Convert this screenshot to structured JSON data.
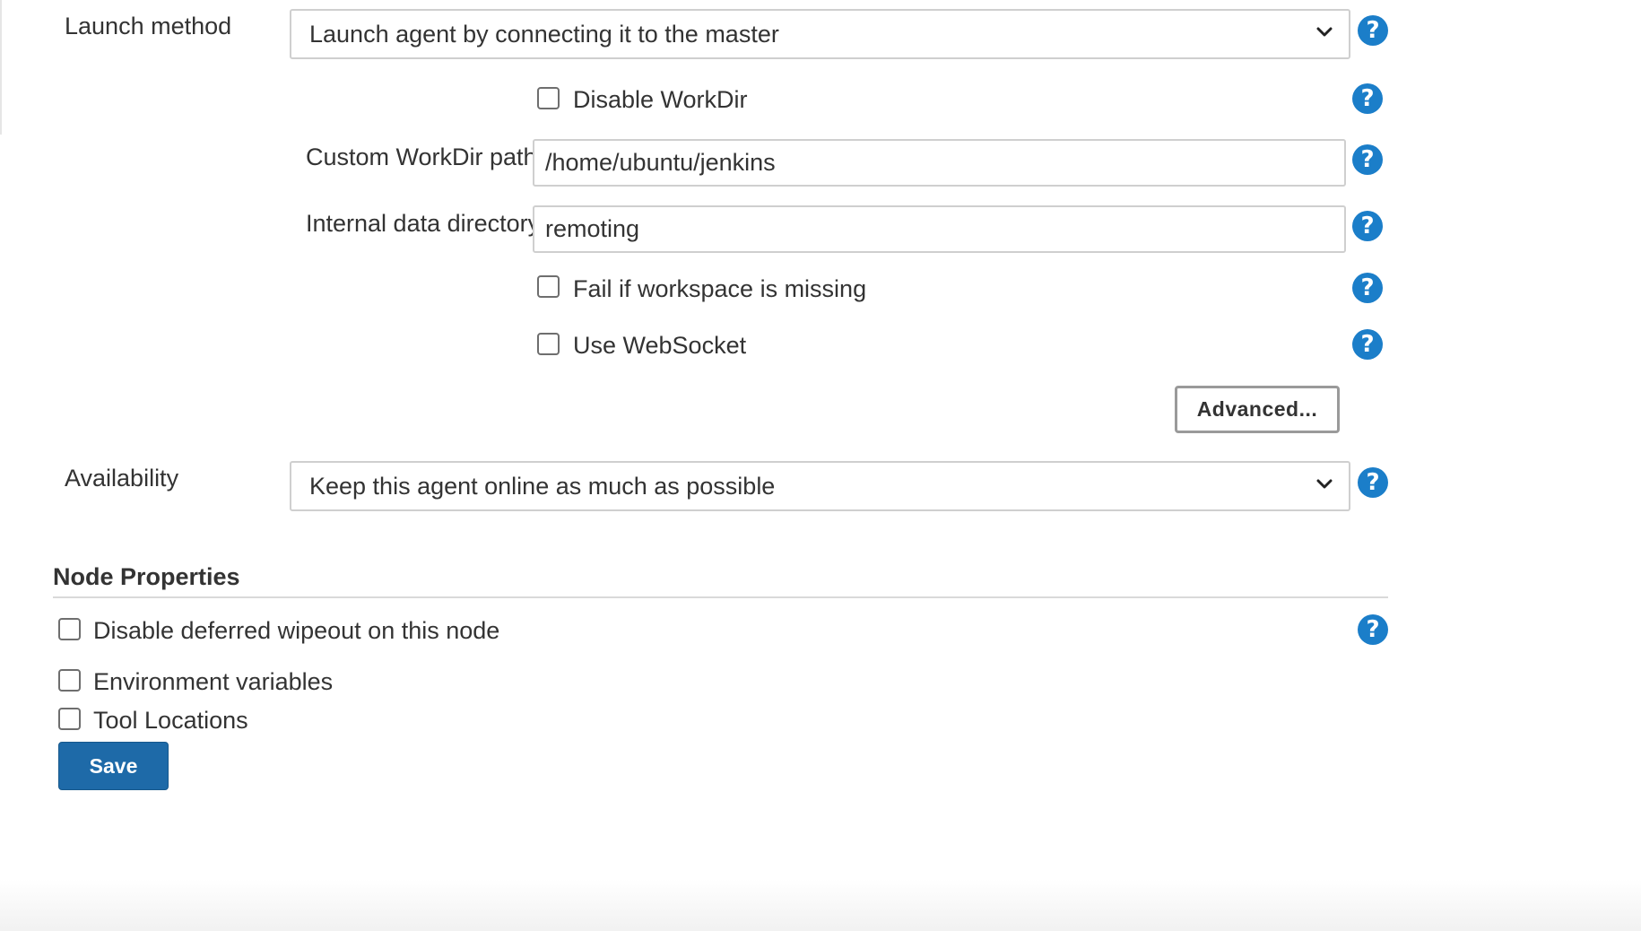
{
  "launch_method": {
    "label": "Launch method",
    "selected": "Launch agent by connecting it to the master"
  },
  "disable_workdir": {
    "label": "Disable WorkDir",
    "checked": false
  },
  "custom_workdir": {
    "label": "Custom WorkDir path",
    "value": "/home/ubuntu/jenkins"
  },
  "internal_data_dir": {
    "label": "Internal data directory",
    "value": "remoting"
  },
  "fail_workspace_missing": {
    "label": "Fail if workspace is missing",
    "checked": false
  },
  "use_websocket": {
    "label": "Use WebSocket",
    "checked": false
  },
  "advanced_button": {
    "label": "Advanced..."
  },
  "availability": {
    "label": "Availability",
    "selected": "Keep this agent online as much as possible"
  },
  "node_properties": {
    "title": "Node Properties",
    "items": [
      {
        "label": "Disable deferred wipeout on this node",
        "checked": false
      },
      {
        "label": "Environment variables",
        "checked": false
      },
      {
        "label": "Tool Locations",
        "checked": false
      }
    ]
  },
  "save_button": {
    "label": "Save"
  },
  "help_icon_glyph": "?",
  "colors": {
    "help_icon": "#1b7ec9",
    "save_button": "#1e6aa8",
    "text": "#333333",
    "border": "#cfcfcf"
  }
}
